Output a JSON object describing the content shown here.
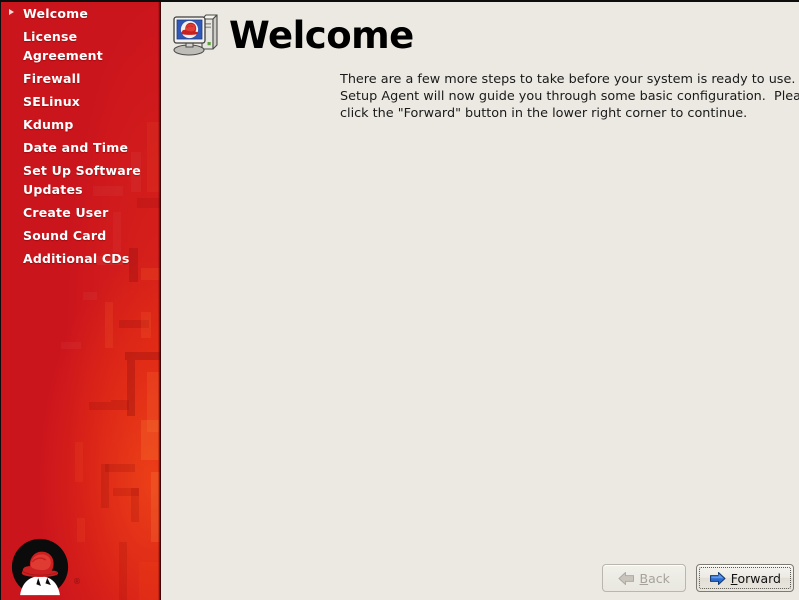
{
  "window": {
    "background_color": "#ece9e2",
    "sidebar_color": "#cb151d"
  },
  "sidebar": {
    "logo_name": "red-hat-shadowman-logo",
    "registered_mark": "®",
    "items": [
      {
        "label": "Welcome",
        "selected": true
      },
      {
        "label": "License Agreement",
        "selected": false
      },
      {
        "label": "Firewall",
        "selected": false
      },
      {
        "label": "SELinux",
        "selected": false
      },
      {
        "label": "Kdump",
        "selected": false
      },
      {
        "label": "Date and Time",
        "selected": false
      },
      {
        "label": "Set Up Software Updates",
        "selected": false
      },
      {
        "label": "Create User",
        "selected": false
      },
      {
        "label": "Sound Card",
        "selected": false
      },
      {
        "label": "Additional CDs",
        "selected": false
      }
    ]
  },
  "main": {
    "icon_name": "computer-redhat-icon",
    "title": "Welcome",
    "body": "There are a few more steps to take before your system is ready to use.  The Setup Agent will now guide you through some basic configuration.  Please click the \"Forward\" button in the lower right corner to continue."
  },
  "buttons": {
    "back": {
      "label": "Back",
      "mnemonic": "B",
      "prefix": "",
      "suffix": "ack",
      "icon_name": "arrow-left-icon",
      "icon_color": "#b9b5ad",
      "disabled": true,
      "focused": false
    },
    "forward": {
      "label": "Forward",
      "mnemonic": "F",
      "prefix": "",
      "suffix": "orward",
      "icon_name": "arrow-right-icon",
      "icon_color": "#2b6cd4",
      "disabled": false,
      "focused": true
    }
  }
}
